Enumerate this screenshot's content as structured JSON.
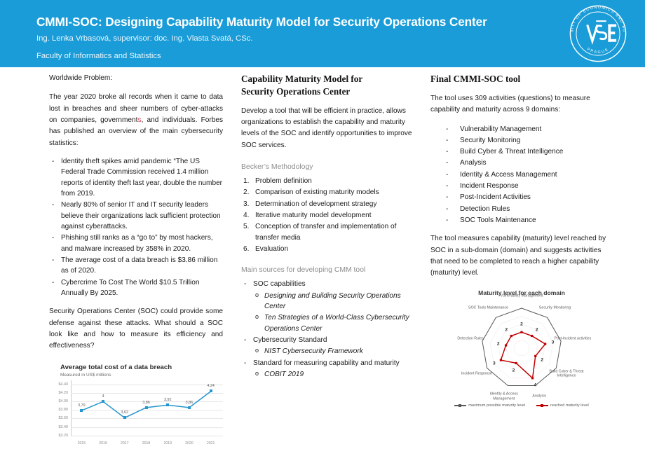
{
  "header": {
    "title": "CMMI-SOC: Designing Capability Maturity Model for Security Operations Center",
    "authors": "Ing. Lenka Vrbasová, supervisor: doc. Ing. Vlasta Svatá, CSc.",
    "faculty": "Faculty of Informatics and Statistics",
    "bg_color": "#199CD8",
    "logo_center": "VŠE",
    "logo_ring_top": "UNIVERSITY OF ECONOMICS AND BUSINESS",
    "logo_ring_bottom": "PRAGUE"
  },
  "left": {
    "heading": "Worldwide Problem:",
    "intro_a": "The year 2020 broke all records when it came to data lost in breaches and sheer numbers of cyber-attacks on companies, government",
    "intro_red": "s",
    "intro_b": ", and individuals. Forbes has published an overview of the main cybersecurity statistics:",
    "bullets": [
      "Identity theft spikes amid pandemic “The US Federal Trade Commission received 1.4 million reports of identity theft last year, double the number from 2019.",
      "Nearly 80% of senior IT and IT security leaders believe their organizations lack sufficient protection against cyberattacks.",
      "Phishing still ranks as a “go to” by most hackers, and malware increased by 358% in 2020.",
      "The average cost of a data breach is $3.86 million as of 2020.",
      "Cybercrime To Cost The World $10.5 Trillion Annually By 2025."
    ],
    "closing": "Security Operations Center (SOC) could provide some defense against these attacks. What should a SOC look like and how to measure its efficiency and effectiveness?"
  },
  "mid": {
    "heading_line1": "Capability Maturity Model for",
    "heading_line2": "Security Operations Center",
    "intro": "Develop a tool that will be efficient in practice, allows organizations to establish the capability and maturity levels of the SOC and identify opportunities to improve SOC services.",
    "methodology_label": "Becker’s Methodology",
    "methodology_steps": [
      "Problem definition",
      "Comparison of existing maturity models",
      "Determination of development strategy",
      "Iterative maturity model development",
      "Conception of transfer and implementation of transfer media",
      "Evaluation"
    ],
    "sources_label": "Main sources for developing CMM tool",
    "sources": [
      {
        "label": "SOC capabilities",
        "items": [
          "Designing and Building Security Operations Center",
          "Ten Strategies of a World-Class Cybersecurity Operations Center"
        ]
      },
      {
        "label": "Cybersecurity Standard",
        "items": [
          "NIST Cybersecurity Framework"
        ]
      },
      {
        "label": "Standard for measuring capability and maturity",
        "items": [
          "COBIT 2019"
        ]
      }
    ]
  },
  "right": {
    "heading": "Final CMMI-SOC tool",
    "intro": "The tool uses 309 activities (questions) to measure capability and maturity across 9 domains:",
    "domains": [
      "Vulnerability Management",
      "Security Monitoring",
      "Build Cyber & Threat Intelligence",
      "Analysis",
      "Identity & Access Management",
      "Incident Response",
      "Post-Incident Activities",
      "Detection Rules",
      "SOC Tools Maintenance"
    ],
    "outro": "The tool measures capability (maturity) level reached by SOC in a sub-domain (domain) and suggests activities that need to be completed to reach a higher capability (maturity) level."
  },
  "chart_data": [
    {
      "type": "line",
      "title": "Average total cost of a data breach",
      "subtitle": "Measured in US$ millions",
      "xlabel": "",
      "ylabel": "",
      "categories": [
        "2015",
        "2016",
        "2017",
        "2018",
        "2019",
        "2020",
        "2021"
      ],
      "values": [
        3.79,
        4,
        3.62,
        3.86,
        3.92,
        3.86,
        4.24
      ],
      "value_labels": [
        "3,79",
        "4",
        "3,62",
        "3,86",
        "3,92",
        "3,86",
        "4,24"
      ],
      "ylim": [
        3.2,
        4.4
      ],
      "yticks": [
        "$3.20",
        "$3.40",
        "$3.60",
        "$3.80",
        "$4.00",
        "$4.20",
        "$4.40"
      ],
      "ytick_values": [
        3.2,
        3.4,
        3.6,
        3.8,
        4.0,
        4.2,
        4.4
      ],
      "grid": true,
      "series_color": "#2596CE",
      "legend": "none"
    },
    {
      "type": "radar",
      "title": "Maturity level for each domain",
      "categories": [
        "Vulnerability Management",
        "Security Monitoring",
        "Post-Incident activities",
        "Build Cyber & Threat Intelligence",
        "Analysis",
        "Identity & Access Management",
        "Incident Response",
        "Detection Rules",
        "SOC Tools Maintenance"
      ],
      "series": [
        {
          "name": "maximum possible maturity level",
          "values": [
            5,
            5,
            5,
            5,
            5,
            5,
            5,
            5,
            5
          ],
          "color": "#595959"
        },
        {
          "name": "reached maturity level",
          "values": [
            2,
            2,
            3,
            2,
            4,
            2,
            3,
            2,
            2
          ],
          "color": "#C00000"
        }
      ],
      "data_labels": [
        "2",
        "2",
        "3",
        "2",
        "4",
        "2",
        "3",
        "2",
        "2"
      ],
      "rlim": [
        0,
        5
      ],
      "grid": true,
      "legend": "bottom"
    }
  ]
}
